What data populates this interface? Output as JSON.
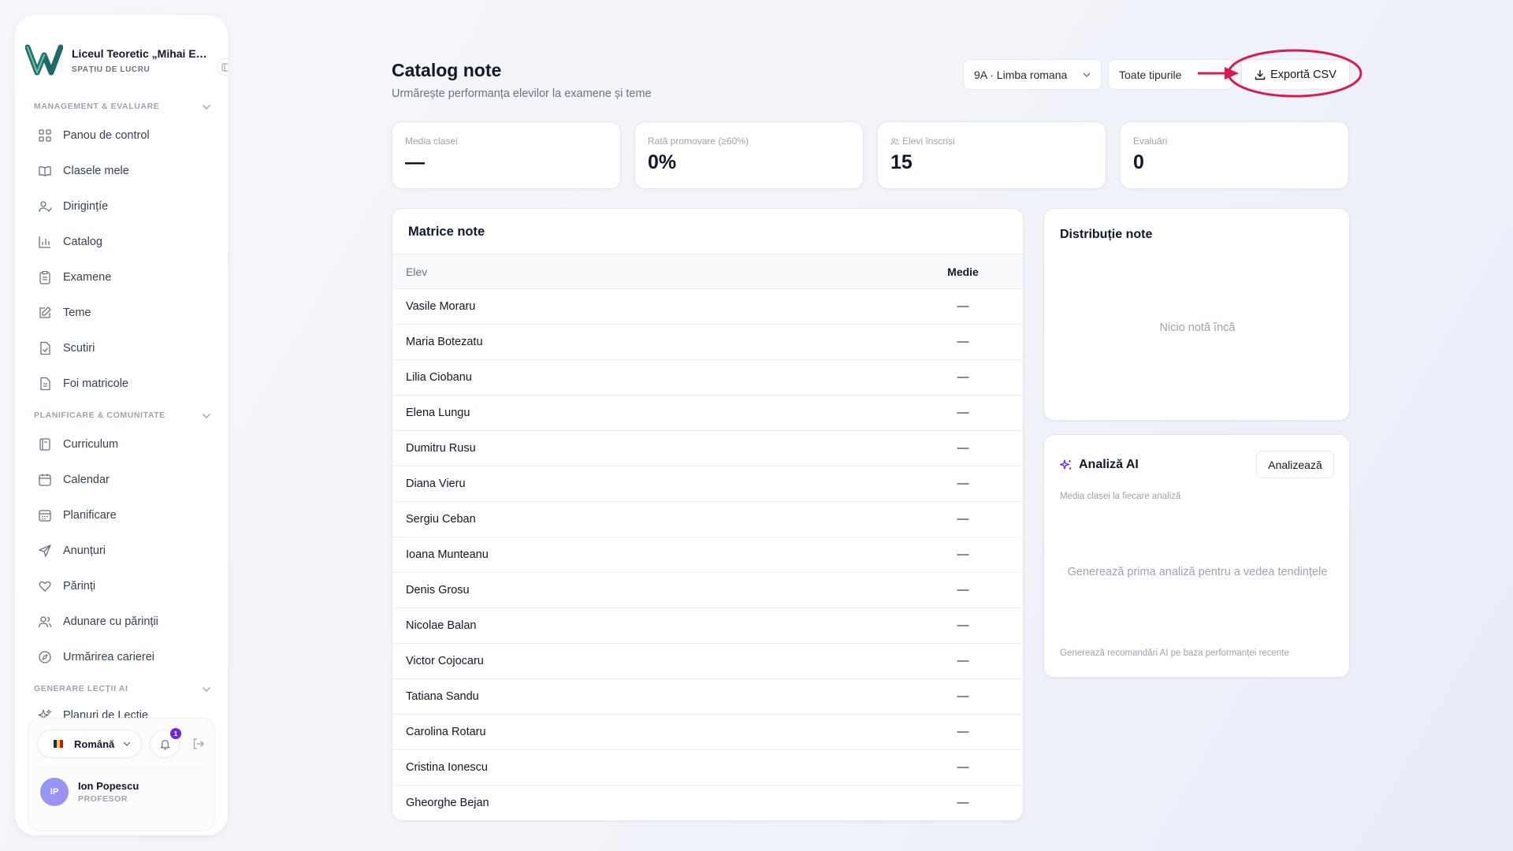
{
  "brand": {
    "name": "Liceul Teoretic „Mihai Eminescu”",
    "subtitle": "SPAȚIU DE LUCRU"
  },
  "sidebar": {
    "sections": [
      {
        "label": "MANAGEMENT & EVALUARE"
      },
      {
        "label": "PLANIFICARE & COMUNITATE"
      },
      {
        "label": "GENERARE LECȚII AI"
      }
    ],
    "items": [
      {
        "label": "Panou de control",
        "icon": "dashboard-icon"
      },
      {
        "label": "Clasele mele",
        "icon": "book-icon"
      },
      {
        "label": "Dirigințíe",
        "icon": "user-check-icon"
      },
      {
        "label": "Catalog",
        "icon": "bar-chart-icon"
      },
      {
        "label": "Examene",
        "icon": "clipboard-icon"
      },
      {
        "label": "Teme",
        "icon": "edit-icon"
      },
      {
        "label": "Scutiri",
        "icon": "file-check-icon"
      },
      {
        "label": "Foi matricole",
        "icon": "file-text-icon"
      },
      {
        "label": "Curriculum",
        "icon": "notebook-icon"
      },
      {
        "label": "Calendar",
        "icon": "calendar-icon"
      },
      {
        "label": "Planificare",
        "icon": "calendar-grid-icon"
      },
      {
        "label": "Anunțuri",
        "icon": "send-icon"
      },
      {
        "label": "Părinți",
        "icon": "heart-icon"
      },
      {
        "label": "Adunare cu părinții",
        "icon": "users-icon"
      },
      {
        "label": "Urmărirea carierei",
        "icon": "compass-icon"
      },
      {
        "label": "Planuri de Lecție",
        "icon": "sparkles-icon"
      }
    ]
  },
  "footer": {
    "language": "Română",
    "notifications_count": "1",
    "user_initials": "IP",
    "user_name": "Ion Popescu",
    "user_role": "PROFESOR"
  },
  "header": {
    "title": "Catalog note",
    "subtitle": "Urmărește performanța elevilor la examene și teme",
    "class_select": "9A · Limba romana",
    "type_select": "Toate tipurile",
    "export_label": "Exportă CSV"
  },
  "stats": [
    {
      "label": "Media clasei",
      "value": "—"
    },
    {
      "label": "Rată promovare (≥60%)",
      "value": "0%"
    },
    {
      "label": "Elevi înscriși",
      "value": "15"
    },
    {
      "label": "Evaluări",
      "value": "0"
    }
  ],
  "matrix": {
    "title": "Matrice note",
    "col_student": "Elev",
    "col_average": "Medie",
    "rows": [
      {
        "name": "Vasile Moraru",
        "avg": "—"
      },
      {
        "name": "Maria Botezatu",
        "avg": "—"
      },
      {
        "name": "Lilia Ciobanu",
        "avg": "—"
      },
      {
        "name": "Elena Lungu",
        "avg": "—"
      },
      {
        "name": "Dumitru Rusu",
        "avg": "—"
      },
      {
        "name": "Diana Vieru",
        "avg": "—"
      },
      {
        "name": "Sergiu Ceban",
        "avg": "—"
      },
      {
        "name": "Ioana Munteanu",
        "avg": "—"
      },
      {
        "name": "Denis Grosu",
        "avg": "—"
      },
      {
        "name": "Nicolae Balan",
        "avg": "—"
      },
      {
        "name": "Victor Cojocaru",
        "avg": "—"
      },
      {
        "name": "Tatiana Sandu",
        "avg": "—"
      },
      {
        "name": "Carolina Rotaru",
        "avg": "—"
      },
      {
        "name": "Cristina Ionescu",
        "avg": "—"
      },
      {
        "name": "Gheorghe Bejan",
        "avg": "—"
      }
    ]
  },
  "distribution": {
    "title": "Distribuție note",
    "empty": "Nicio notă încă"
  },
  "ai": {
    "title": "Analiză AI",
    "button": "Analizează",
    "subtitle": "Media clasei la fiecare analiză",
    "empty": "Generează prima analiză pentru a vedea tendințele",
    "footer": "Generează recomandări AI pe baza performanței recente"
  },
  "colors": {
    "accent_purple": "#6d28d9",
    "annotation_red": "#d81b4f",
    "logo_teal": "#1f6b63"
  }
}
